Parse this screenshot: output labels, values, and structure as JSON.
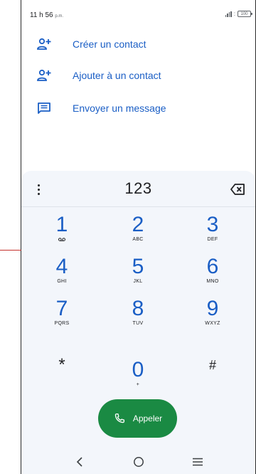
{
  "status_bar": {
    "time": "11 h 56",
    "ampm": "p.m.",
    "battery": "100",
    "signal_icon": "signal-icon"
  },
  "actions": [
    {
      "label": "Créer un contact",
      "icon": "add-person-icon"
    },
    {
      "label": "Ajouter à un contact",
      "icon": "add-person-icon"
    },
    {
      "label": "Envoyer un message",
      "icon": "message-icon"
    }
  ],
  "dialer": {
    "digits": "123",
    "more_icon": "more-vert-icon",
    "backspace_icon": "backspace-icon"
  },
  "keys": [
    {
      "digit": "1",
      "letters": ""
    },
    {
      "digit": "2",
      "letters": "ABC"
    },
    {
      "digit": "3",
      "letters": "DEF"
    },
    {
      "digit": "4",
      "letters": "GHI"
    },
    {
      "digit": "5",
      "letters": "JKL"
    },
    {
      "digit": "6",
      "letters": "MNO"
    },
    {
      "digit": "7",
      "letters": "PQRS"
    },
    {
      "digit": "8",
      "letters": "TUV"
    },
    {
      "digit": "9",
      "letters": "WXYZ"
    },
    {
      "digit": "*",
      "letters": ""
    },
    {
      "digit": "0",
      "letters": "+"
    },
    {
      "digit": "#",
      "letters": ""
    }
  ],
  "call_button": {
    "label": "Appeler",
    "icon": "phone-icon"
  },
  "nav": {
    "back_icon": "back-chevron-icon",
    "home_icon": "home-circle-icon",
    "menu_icon": "menu-lines-icon"
  },
  "colors": {
    "accent": "#1a5ec5",
    "call_green": "#1a8a43",
    "keypad_bg": "#f3f6fb"
  }
}
